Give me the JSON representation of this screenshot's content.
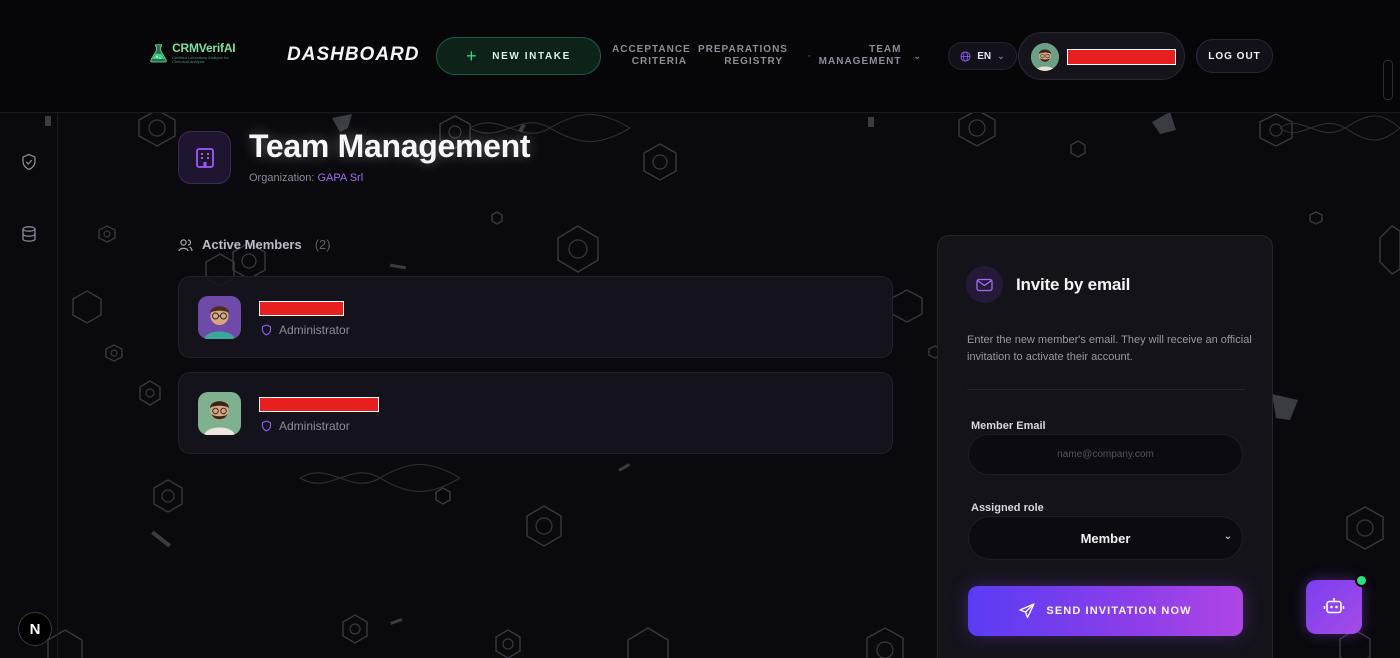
{
  "header": {
    "logo_text": "CRMVerifAI",
    "logo_subtext": "Certified Laboratory Analysis for Chemical Analysis",
    "dashboard_title": "DASHBOARD",
    "new_intake_label": "NEW INTAKE",
    "nav": {
      "acceptance_line1": "ACCEPTANCE",
      "acceptance_line2": "CRITERIA",
      "preparations_line1": "PREPARATIONS",
      "preparations_line2": "REGISTRY",
      "team_line1": "TEAM",
      "team_line2": "MANAGEMENT"
    },
    "language": "EN",
    "logout_label": "LOG OUT"
  },
  "rail": {
    "icons": [
      "shield-check-icon",
      "database-icon"
    ],
    "framework_badge": "N"
  },
  "page": {
    "title": "Team Management",
    "org_label": "Organization:",
    "org_name": "GAPA Srl"
  },
  "members": {
    "section_label": "Active Members",
    "count": "(2)",
    "items": [
      {
        "role": "Administrator",
        "avatar": "avatar-glasses-man"
      },
      {
        "role": "Administrator",
        "avatar": "avatar-bearded-man"
      }
    ]
  },
  "invite": {
    "title": "Invite by email",
    "description": "Enter the new member's email. They will receive an official invitation to activate their account.",
    "email_label": "Member Email",
    "email_placeholder": "name@company.com",
    "email_value": "",
    "role_label": "Assigned role",
    "role_value": "Member",
    "send_label": "SEND INVITATION NOW"
  },
  "colors": {
    "background": "#0a090e",
    "accent_purple": "#8b3ee8",
    "accent_green": "#35d38b",
    "org_name": "#a46cf0",
    "online_dot": "#2be080"
  }
}
